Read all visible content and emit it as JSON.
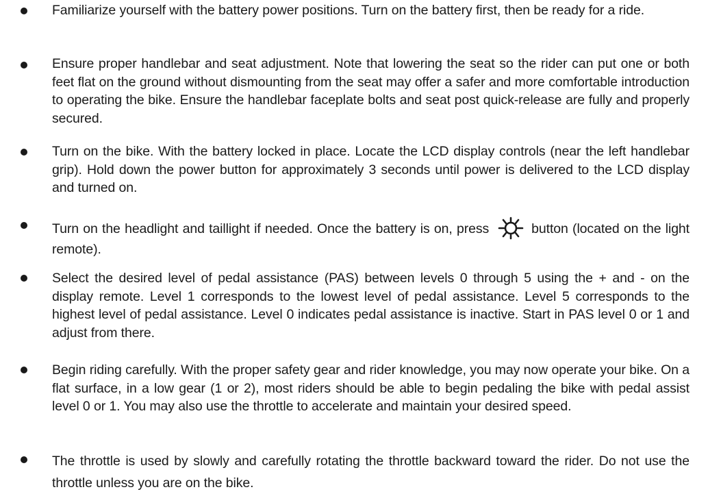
{
  "instructions": [
    {
      "text": "Familiarize yourself with the battery power positions. Turn on the battery first, then be ready for a ride."
    },
    {
      "text": "Ensure proper handlebar and seat adjustment. Note that lowering the seat so the rider can put one or both feet flat on the ground without dismounting from the seat may offer a safer and more comfortable introduction to operating the bike. Ensure the handlebar faceplate bolts and seat post quick-release are fully and properly secured."
    },
    {
      "text": "Turn on the bike. With the battery locked in place. Locate the LCD display controls (near the left handlebar grip). Hold down the power button for approximately 3 seconds until power is delivered to the LCD display and turned on."
    },
    {
      "text_before_icon": "Turn on the headlight and taillight if needed. Once the battery is on, press",
      "icon": "light-button-icon",
      "text_after_icon": "button (located on the light remote)."
    },
    {
      "text": "Select the desired level of pedal assistance (PAS) between levels 0 through 5 using the + and - on the display remote. Level 1 corresponds to the lowest level of pedal assistance. Level 5 corresponds to the highest level of pedal assistance. Level 0 indicates pedal assistance is inactive. Start in PAS level 0 or 1 and adjust from there."
    },
    {
      "text": "Begin riding carefully. With the proper safety gear and rider knowledge, you may now operate your bike. On a flat surface, in a low gear (1 or 2), most riders should be able to begin pedaling the bike with pedal assist level 0 or 1. You may also use the throttle to accelerate and maintain your desired speed."
    },
    {
      "text": "The throttle is used by slowly and carefully rotating the throttle backward toward the rider. Do not use the throttle unless you are on the bike."
    }
  ]
}
